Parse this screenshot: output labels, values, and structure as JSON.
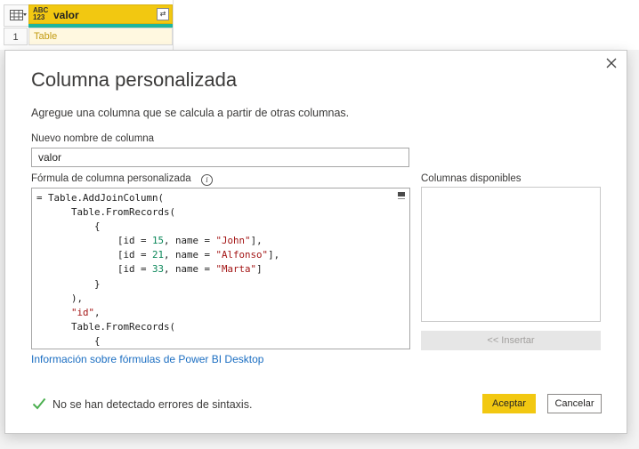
{
  "grid": {
    "column_type": "ABC\n123",
    "column_name": "valor",
    "row_number": "1",
    "cell_value": "Table"
  },
  "dialog": {
    "title": "Columna personalizada",
    "description": "Agregue una columna que se calcula a partir de otras columnas.",
    "new_column_label": "Nuevo nombre de columna",
    "new_column_value": "valor",
    "formula_label": "Fórmula de columna personalizada",
    "available_columns_label": "Columnas disponibles",
    "insert_button": "<< Insertar",
    "help_link": "Información sobre fórmulas de Power BI Desktop",
    "status": "No se han detectado errores de sintaxis.",
    "ok_button": "Aceptar",
    "cancel_button": "Cancelar"
  },
  "formula_lines": [
    [
      {
        "t": "= Table.AddJoinColumn("
      }
    ],
    [
      {
        "t": "      Table.FromRecords("
      }
    ],
    [
      {
        "t": "          {"
      }
    ],
    [
      {
        "t": "              [id = "
      },
      {
        "t": "15",
        "c": "num"
      },
      {
        "t": ", name = "
      },
      {
        "t": "\"John\"",
        "c": "str"
      },
      {
        "t": "],"
      }
    ],
    [
      {
        "t": "              [id = "
      },
      {
        "t": "21",
        "c": "num"
      },
      {
        "t": ", name = "
      },
      {
        "t": "\"Alfonso\"",
        "c": "str"
      },
      {
        "t": "],"
      }
    ],
    [
      {
        "t": "              [id = "
      },
      {
        "t": "33",
        "c": "num"
      },
      {
        "t": ", name = "
      },
      {
        "t": "\"Marta\"",
        "c": "str"
      },
      {
        "t": "]"
      }
    ],
    [
      {
        "t": "          }"
      }
    ],
    [
      {
        "t": "      ),"
      }
    ],
    [
      {
        "t": "      "
      },
      {
        "t": "\"id\"",
        "c": "str"
      },
      {
        "t": ","
      }
    ],
    [
      {
        "t": "      Table.FromRecords("
      }
    ],
    [
      {
        "t": "          {"
      }
    ]
  ],
  "colors": {
    "accent": "#f2c811",
    "link": "#1b6ec2",
    "check": "#4caf50",
    "number": "#098658",
    "string": "#a31515"
  }
}
